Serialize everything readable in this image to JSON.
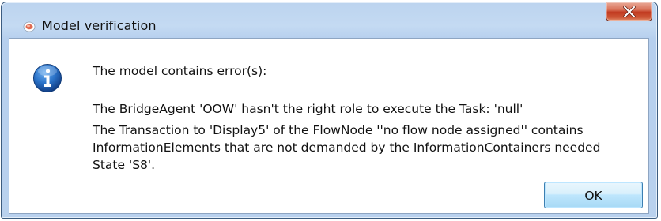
{
  "window": {
    "title": "Model verification",
    "app_icon": "app-icon",
    "close_icon": "close-icon"
  },
  "dialog": {
    "icon": "info-icon",
    "heading": "The model contains error(s):",
    "errors": [
      "The BridgeAgent 'OOW' hasn't the right role to execute the Task: 'null'",
      "The Transaction to 'Display5' of the FlowNode ''no flow node assigned'' contains\nInformationElements that are not demanded by the InformationContainers needed\nState 'S8'."
    ],
    "ok_label": "OK"
  },
  "colors": {
    "frame": "#b9d1ee",
    "close_button": "#c1391f",
    "info_icon": "#1e5fae",
    "ok_button_border": "#3c7fb1"
  }
}
